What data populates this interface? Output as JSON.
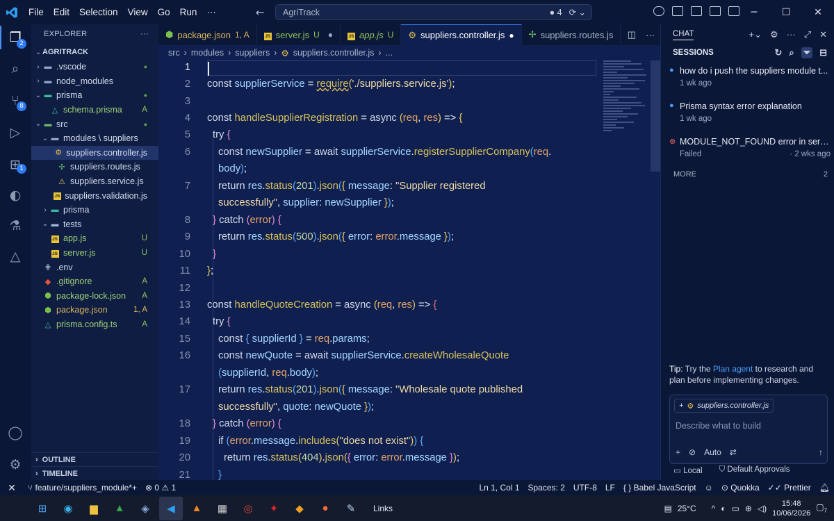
{
  "titlebar": {
    "menus": [
      "File",
      "Edit",
      "Selection",
      "View",
      "Go",
      "Run",
      "···"
    ],
    "search": "AgriTrack",
    "search_badge": "● 4"
  },
  "activity": {
    "badges": {
      "explorer": "2",
      "scm": "8",
      "extensions": "1"
    }
  },
  "explorer": {
    "title": "EXPLORER",
    "project": "AGRITRACK",
    "rows": [
      {
        "label": ".vscode",
        "indent": 1,
        "chev": "›",
        "icon": "folder",
        "status": "●",
        "cls": "dot"
      },
      {
        "label": "node_modules",
        "indent": 1,
        "chev": "›",
        "icon": "folder",
        "status": "",
        "cls": ""
      },
      {
        "label": "prisma",
        "indent": 1,
        "chev": "⌄",
        "icon": "folder-prisma",
        "status": "●",
        "cls": "dot"
      },
      {
        "label": "schema.prisma",
        "indent": 2,
        "chev": "",
        "icon": "prisma",
        "status": "A",
        "cls": "a"
      },
      {
        "label": "src",
        "indent": 1,
        "chev": "⌄",
        "icon": "folder-src",
        "status": "●",
        "cls": "dot"
      },
      {
        "label": "modules \\ suppliers",
        "indent": 2,
        "chev": "⌄",
        "icon": "folder",
        "status": "",
        "cls": ""
      },
      {
        "label": "suppliers.controller.js",
        "indent": 3,
        "chev": "",
        "icon": "gear",
        "status": "",
        "cls": "",
        "selected": true
      },
      {
        "label": "suppliers.routes.js",
        "indent": 3,
        "chev": "",
        "icon": "route",
        "status": "",
        "cls": ""
      },
      {
        "label": "suppliers.service.js",
        "indent": 3,
        "chev": "",
        "icon": "warn",
        "status": "",
        "cls": ""
      },
      {
        "label": "suppliers.validation.js",
        "indent": 3,
        "chev": "",
        "icon": "js",
        "status": "",
        "cls": ""
      },
      {
        "label": "prisma",
        "indent": 2,
        "chev": "›",
        "icon": "folder-prisma",
        "status": "",
        "cls": ""
      },
      {
        "label": "tests",
        "indent": 2,
        "chev": "⌄",
        "icon": "folder-tests",
        "status": "",
        "cls": ""
      },
      {
        "label": "app.js",
        "indent": 2,
        "chev": "",
        "icon": "js",
        "status": "U",
        "cls": "u"
      },
      {
        "label": "server.js",
        "indent": 2,
        "chev": "",
        "icon": "js",
        "status": "U",
        "cls": "u"
      },
      {
        "label": ".env",
        "indent": 1,
        "chev": "",
        "icon": "env",
        "status": "",
        "cls": ""
      },
      {
        "label": ".gitignore",
        "indent": 1,
        "chev": "",
        "icon": "git",
        "status": "A",
        "cls": "a"
      },
      {
        "label": "package-lock.json",
        "indent": 1,
        "chev": "",
        "icon": "npm",
        "status": "A",
        "cls": "a"
      },
      {
        "label": "package.json",
        "indent": 1,
        "chev": "",
        "icon": "npm",
        "status": "1, A",
        "cls": "warn"
      },
      {
        "label": "prisma.config.ts",
        "indent": 1,
        "chev": "",
        "icon": "prisma",
        "status": "A",
        "cls": "a"
      }
    ],
    "outline": "OUTLINE",
    "timeline": "TIMELINE"
  },
  "tabs": [
    {
      "label": "package.json",
      "status": "1, A",
      "icon": "npm",
      "cls": "warn-tab"
    },
    {
      "label": "server.js",
      "status": "U",
      "extra": "●",
      "icon": "js",
      "cls": "u-tab"
    },
    {
      "label": "app.js",
      "status": "U",
      "icon": "js",
      "cls": "u-tab",
      "italic": true
    },
    {
      "label": "suppliers.controller.js",
      "status": "●",
      "icon": "gear",
      "cls": "",
      "active": true
    },
    {
      "label": "suppliers.routes.js",
      "status": "",
      "icon": "route",
      "cls": ""
    }
  ],
  "breadcrumb": [
    "src",
    "modules",
    "suppliers",
    "suppliers.controller.js",
    "..."
  ],
  "code": {
    "line_numbers": [
      "1",
      "2",
      "3",
      "4",
      "5",
      "6",
      "",
      "7",
      "",
      "8",
      "9",
      "10",
      "11",
      "12",
      "13",
      "14",
      "15",
      "16",
      "",
      "17",
      "",
      "18",
      "19",
      "20",
      "21"
    ]
  },
  "chat": {
    "title": "CHAT",
    "sessions_title": "SESSIONS",
    "sessions": [
      {
        "title": "how do i push the suppliers module t...",
        "meta": "1 wk ago",
        "ago": "",
        "icon": "●"
      },
      {
        "title": "Prisma syntax error explanation",
        "meta": "1 wk ago",
        "ago": "",
        "icon": "●"
      },
      {
        "title": "MODULE_NOT_FOUND error in server",
        "meta": "Failed",
        "ago": "· 2 wks ago",
        "icon": "⊗"
      }
    ],
    "more": "MORE",
    "more_count": "2",
    "tip_label": "Tip:",
    "tip_pre": " Try the ",
    "tip_link": "Plan agent",
    "tip_post": " to research and plan before implementing changes.",
    "context_file": "suppliers.controller.js",
    "placeholder": "Describe what to build",
    "mode": "Auto",
    "footer_local": "Local",
    "footer_approvals": "Default Approvals"
  },
  "status": {
    "branch": "feature/suppliers_module*+",
    "problems": "⊗ 0 ⚠ 1",
    "position": "Ln 1, Col 1",
    "spaces": "Spaces: 2",
    "encoding": "UTF-8",
    "eol": "LF",
    "language": "{ } Babel JavaScript",
    "quokka": "Quokka",
    "prettier": "✓✓ Prettier"
  },
  "taskbar": {
    "links": "Links",
    "temp": "25°C",
    "time": "15:48",
    "date": "10/06/2026",
    "notif": "7"
  }
}
